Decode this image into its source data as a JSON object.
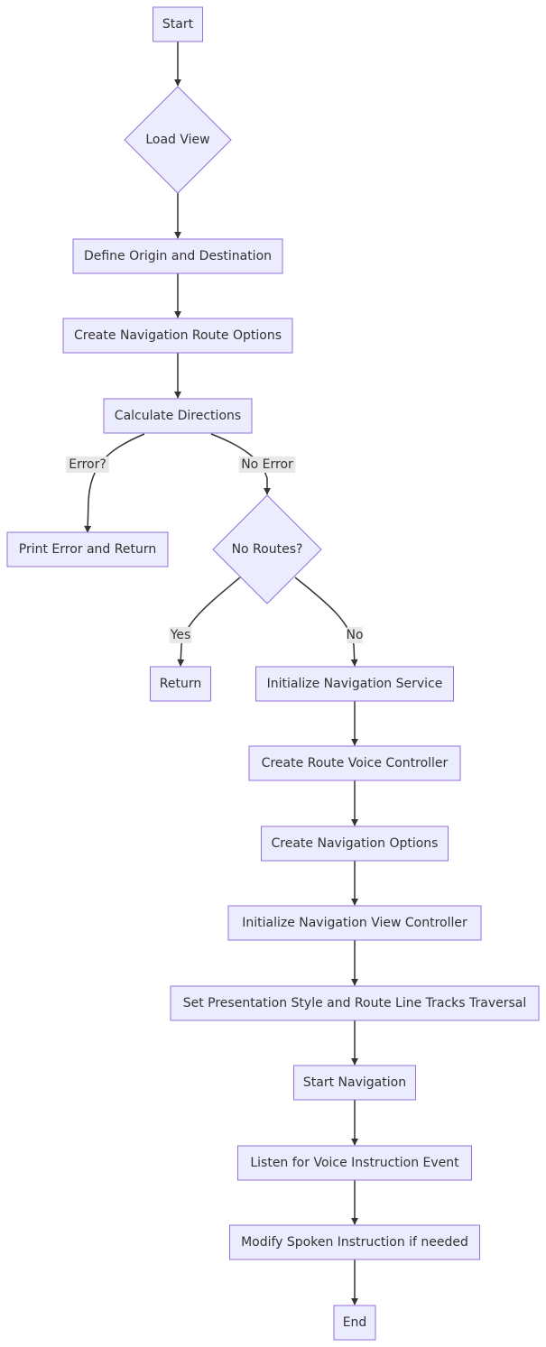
{
  "diagram": {
    "type": "flowchart",
    "direction": "top-down",
    "colors": {
      "node_fill": "#ECECFF",
      "node_stroke": "#9370DB",
      "edge": "#333333",
      "text": "#333333",
      "label_bg": "#e8e8e8"
    },
    "nodes": [
      {
        "id": "start",
        "label": "Start",
        "shape": "rect"
      },
      {
        "id": "load_view",
        "label": "Load View",
        "shape": "diamond"
      },
      {
        "id": "define_od",
        "label": "Define Origin and Destination",
        "shape": "rect"
      },
      {
        "id": "create_route_opts",
        "label": "Create Navigation Route Options",
        "shape": "rect"
      },
      {
        "id": "calc_dirs",
        "label": "Calculate Directions",
        "shape": "rect"
      },
      {
        "id": "print_error",
        "label": "Print Error and Return",
        "shape": "rect"
      },
      {
        "id": "no_routes",
        "label": "No Routes?",
        "shape": "diamond"
      },
      {
        "id": "return",
        "label": "Return",
        "shape": "rect"
      },
      {
        "id": "init_nav_service",
        "label": "Initialize Navigation Service",
        "shape": "rect"
      },
      {
        "id": "create_voice_ctrl",
        "label": "Create Route Voice Controller",
        "shape": "rect"
      },
      {
        "id": "create_nav_opts",
        "label": "Create Navigation Options",
        "shape": "rect"
      },
      {
        "id": "init_nav_vc",
        "label": "Initialize Navigation View Controller",
        "shape": "rect"
      },
      {
        "id": "set_presentation",
        "label": "Set Presentation Style and Route Line Tracks Traversal",
        "shape": "rect"
      },
      {
        "id": "start_nav",
        "label": "Start Navigation",
        "shape": "rect"
      },
      {
        "id": "listen_voice",
        "label": "Listen for Voice Instruction Event",
        "shape": "rect"
      },
      {
        "id": "modify_spoken",
        "label": "Modify Spoken Instruction if needed",
        "shape": "rect"
      },
      {
        "id": "end",
        "label": "End",
        "shape": "rect"
      }
    ],
    "edges": [
      {
        "from": "start",
        "to": "load_view",
        "label": ""
      },
      {
        "from": "load_view",
        "to": "define_od",
        "label": ""
      },
      {
        "from": "define_od",
        "to": "create_route_opts",
        "label": ""
      },
      {
        "from": "create_route_opts",
        "to": "calc_dirs",
        "label": ""
      },
      {
        "from": "calc_dirs",
        "to": "print_error",
        "label": "Error?"
      },
      {
        "from": "calc_dirs",
        "to": "no_routes",
        "label": "No Error"
      },
      {
        "from": "no_routes",
        "to": "return",
        "label": "Yes"
      },
      {
        "from": "no_routes",
        "to": "init_nav_service",
        "label": "No"
      },
      {
        "from": "init_nav_service",
        "to": "create_voice_ctrl",
        "label": ""
      },
      {
        "from": "create_voice_ctrl",
        "to": "create_nav_opts",
        "label": ""
      },
      {
        "from": "create_nav_opts",
        "to": "init_nav_vc",
        "label": ""
      },
      {
        "from": "init_nav_vc",
        "to": "set_presentation",
        "label": ""
      },
      {
        "from": "set_presentation",
        "to": "start_nav",
        "label": ""
      },
      {
        "from": "start_nav",
        "to": "listen_voice",
        "label": ""
      },
      {
        "from": "listen_voice",
        "to": "modify_spoken",
        "label": ""
      },
      {
        "from": "modify_spoken",
        "to": "end",
        "label": ""
      }
    ]
  }
}
